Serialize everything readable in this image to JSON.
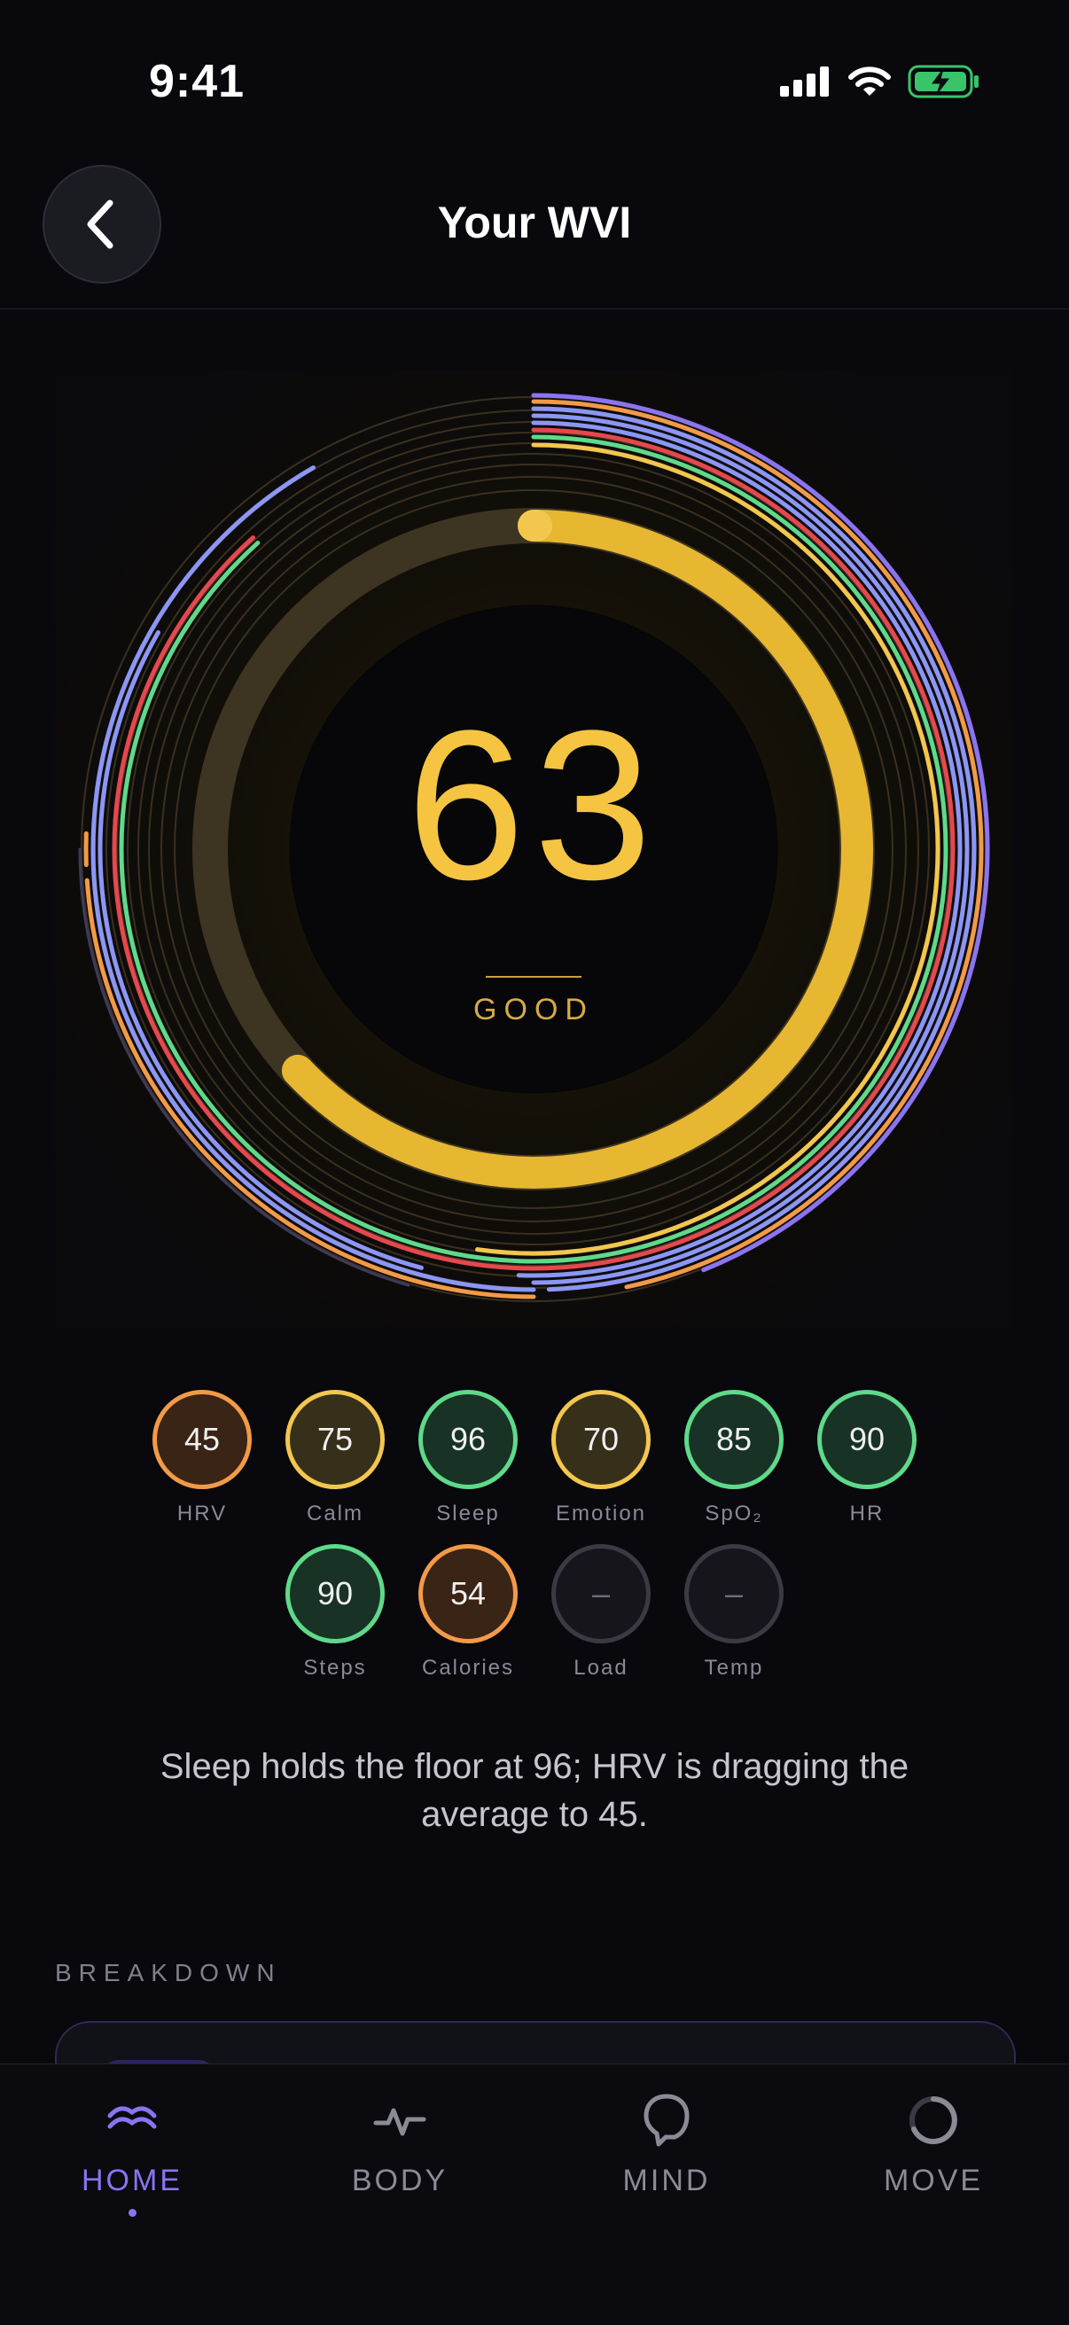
{
  "status_bar": {
    "time": "9:41"
  },
  "header": {
    "title": "Your WVI"
  },
  "score": {
    "value": "63",
    "label": "GOOD",
    "fraction": 0.63
  },
  "colors": {
    "orange": "#f29a48",
    "yellow": "#f3c64e",
    "green": "#5fd98a",
    "red": "#e5484d",
    "periwinkle": "#8b96f5",
    "violet": "#8a74f2",
    "gold": "#e8b731"
  },
  "metrics_row1": [
    {
      "value": "45",
      "label": "HRV",
      "tone": "orange"
    },
    {
      "value": "75",
      "label": "Calm",
      "tone": "yellow"
    },
    {
      "value": "96",
      "label": "Sleep",
      "tone": "green"
    },
    {
      "value": "70",
      "label": "Emotion",
      "tone": "yellow"
    },
    {
      "value": "85",
      "label": "SpO₂",
      "tone": "green"
    },
    {
      "value": "90",
      "label": "HR",
      "tone": "green"
    }
  ],
  "metrics_row2": [
    {
      "value": "90",
      "label": "Steps",
      "tone": "green"
    },
    {
      "value": "54",
      "label": "Calories",
      "tone": "orange"
    },
    {
      "value": "–",
      "label": "Load",
      "tone": "gray"
    },
    {
      "value": "–",
      "label": "Temp",
      "tone": "gray"
    }
  ],
  "summary": "Sleep holds the floor at 96; HRV is dragging the average to 45.",
  "breakdown": {
    "label": "BREAKDOWN"
  },
  "tabs": [
    {
      "label": "HOME",
      "icon": "home-waves-icon",
      "active": true
    },
    {
      "label": "BODY",
      "icon": "pulse-icon",
      "active": false
    },
    {
      "label": "MIND",
      "icon": "head-icon",
      "active": false
    },
    {
      "label": "MOVE",
      "icon": "ring-icon",
      "active": false
    }
  ]
}
